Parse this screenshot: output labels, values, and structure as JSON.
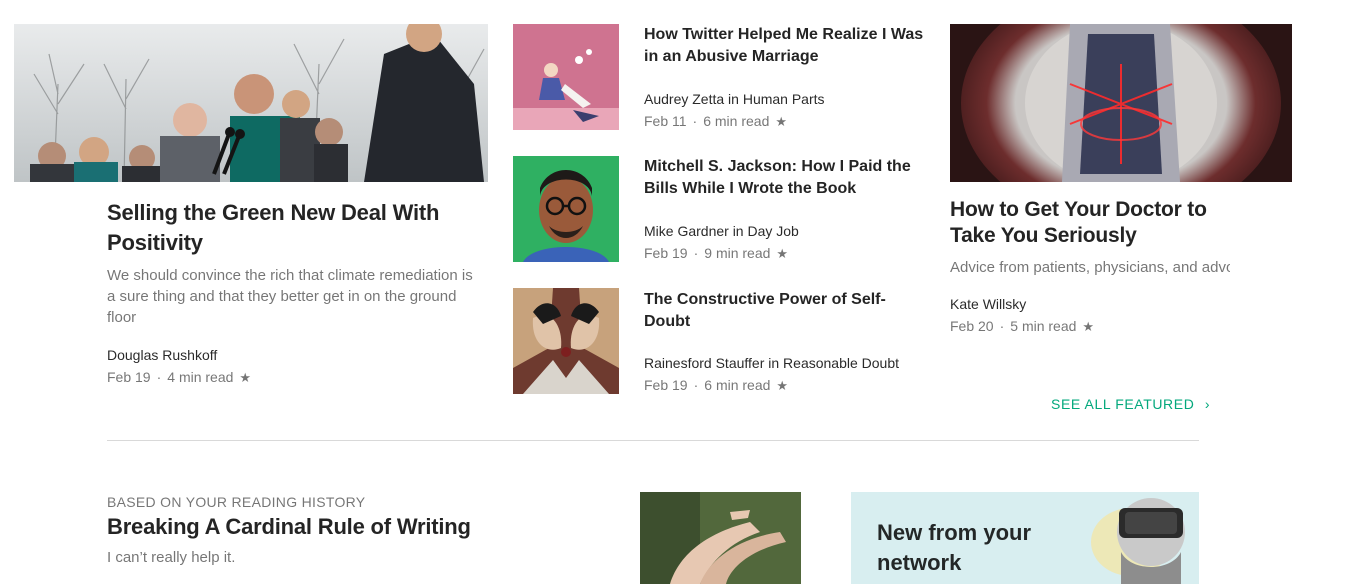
{
  "featured": {
    "main": {
      "title": "Selling the Green New Deal With Positivity",
      "subtitle": "We should convince the rich that climate remediation is a sure thing and that they better get in on the ground floor",
      "author": "Douglas Rushkoff",
      "date": "Feb 19",
      "read_time": "4 min read"
    },
    "list": [
      {
        "title": "How Twitter Helped Me Realize I Was in an Abusive Marriage",
        "author_line": "Audrey Zetta in Human Parts",
        "date": "Feb 11",
        "read_time": "6 min read"
      },
      {
        "title": "Mitchell S. Jackson: How I Paid the Bills While I Wrote the Book",
        "author_line": "Mike Gardner in Day Job",
        "date": "Feb 19",
        "read_time": "9 min read"
      },
      {
        "title": "The Constructive Power of Self-Doubt",
        "author_line": "Rainesford Stauffer in Reasonable Doubt",
        "date": "Feb 19",
        "read_time": "6 min read"
      }
    ],
    "right": {
      "title": "How to Get Your Doctor to Take You Seriously",
      "subtitle": "Advice from patients, physicians, and advo",
      "author": "Kate Willsky",
      "date": "Feb 20",
      "read_time": "5 min read"
    },
    "see_all": "SEE ALL FEATURED",
    "see_all_chevron": "›"
  },
  "reading_history": {
    "kicker": "BASED ON YOUR READING HISTORY",
    "title": "Breaking A Cardinal Rule of Writing",
    "subtitle": "I can’t really help it."
  },
  "network_card": {
    "title_line1": "New from your",
    "title_line2": "network"
  },
  "glyphs": {
    "dot": "·",
    "star": "★"
  },
  "colors": {
    "accent": "#03a87c",
    "card_bg": "#d8eef0"
  }
}
